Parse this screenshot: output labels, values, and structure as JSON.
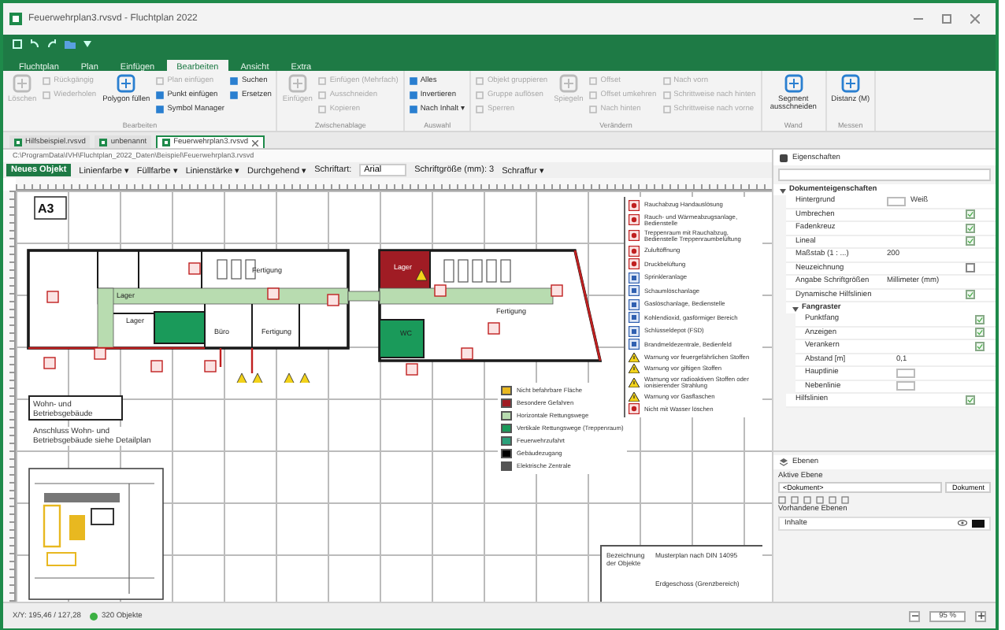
{
  "window": {
    "title": "Feuerwehrplan3.rvsvd - Fluchtplan 2022"
  },
  "ribbon_tabs": [
    {
      "label": "Fluchtplan",
      "selected": false
    },
    {
      "label": "Plan",
      "selected": false
    },
    {
      "label": "Einfügen",
      "selected": false
    },
    {
      "label": "Bearbeiten",
      "selected": true
    },
    {
      "label": "Ansicht",
      "selected": false
    },
    {
      "label": "Extra",
      "selected": false
    }
  ],
  "ribbon_groups": [
    {
      "label": "Bearbeiten",
      "items": [
        {
          "kind": "large",
          "label": "Löschen",
          "disabled": true
        },
        {
          "kind": "small",
          "label": "Rückgängig",
          "disabled": true
        },
        {
          "kind": "small",
          "label": "Wiederholen",
          "disabled": true
        },
        {
          "kind": "large",
          "label": "Polygon füllen",
          "disabled": false
        },
        {
          "kind": "small",
          "label": "Plan einfügen",
          "disabled": true
        },
        {
          "kind": "small",
          "label": "Punkt einfügen",
          "disabled": false
        },
        {
          "kind": "small",
          "label": "Symbol Manager",
          "disabled": false
        },
        {
          "kind": "small",
          "label": "Suchen",
          "disabled": false
        },
        {
          "kind": "small",
          "label": "Ersetzen",
          "disabled": false
        }
      ]
    },
    {
      "label": "Zwischenablage",
      "items": [
        {
          "kind": "large",
          "label": "Einfügen",
          "disabled": true
        },
        {
          "kind": "small",
          "label": "Einfügen (Mehrfach)",
          "disabled": true
        },
        {
          "kind": "small",
          "label": "Ausschneiden",
          "disabled": true
        },
        {
          "kind": "small",
          "label": "Kopieren",
          "disabled": true
        }
      ]
    },
    {
      "label": "Auswahl",
      "items": [
        {
          "kind": "small",
          "label": "Alles",
          "disabled": false
        },
        {
          "kind": "small",
          "label": "Invertieren",
          "disabled": false
        },
        {
          "kind": "small",
          "label": "Nach Inhalt ▾",
          "disabled": false
        }
      ]
    },
    {
      "label": "Verändern",
      "items": [
        {
          "kind": "small",
          "label": "Objekt gruppieren",
          "disabled": true
        },
        {
          "kind": "small",
          "label": "Gruppe auflösen",
          "disabled": true
        },
        {
          "kind": "small",
          "label": "Sperren",
          "disabled": true
        },
        {
          "kind": "large",
          "label": "Spiegeln",
          "disabled": true
        },
        {
          "kind": "small",
          "label": "Offset",
          "disabled": true
        },
        {
          "kind": "small",
          "label": "Offset umkehren",
          "disabled": true
        },
        {
          "kind": "small",
          "label": "Nach hinten",
          "disabled": true
        },
        {
          "kind": "small",
          "label": "Nach vorn",
          "disabled": true
        },
        {
          "kind": "small",
          "label": "Schrittweise nach hinten",
          "disabled": true
        },
        {
          "kind": "small",
          "label": "Schrittweise nach vorne",
          "disabled": true
        }
      ]
    },
    {
      "label": "Wand",
      "items": [
        {
          "kind": "large",
          "label": "Segment ausschneiden",
          "disabled": false
        }
      ]
    },
    {
      "label": "Messen",
      "items": [
        {
          "kind": "large",
          "label": "Distanz (M)",
          "disabled": false
        }
      ]
    }
  ],
  "document_tabs": [
    {
      "label": "Hilfsbeispiel.rvsvd",
      "selected": false
    },
    {
      "label": "unbenannt",
      "selected": false
    },
    {
      "label": "Feuerwehrplan3.rvsvd",
      "selected": true
    }
  ],
  "path": "C:\\ProgramData\\IVH\\Fluchtplan_2022_Daten\\Beispiel\\Feuerwehrplan3.rvsvd",
  "toolbar": {
    "new_object": "Neues Objekt",
    "line_color": "Linienfarbe ▾",
    "fill_color": "Füllfarbe ▾",
    "line_width": "Linienstärke ▾",
    "line_style": "Durchgehend ▾",
    "font_label": "Schriftart:",
    "font": "Arial",
    "font_size": "Schriftgröße (mm): 3",
    "hatch": "Schraffur ▾"
  },
  "plan": {
    "sheet_size": "A3",
    "rooms": [
      "Fertigung",
      "Büro",
      "Lager",
      "Fertigung",
      "Lager",
      "WC",
      "Fertigung",
      "Lager"
    ],
    "building_note": "Wohn- und Betriebsgebäude",
    "detail_note": "Anschluss Wohn- und Betriebsgebäude siehe Detailplan"
  },
  "legend_areas": [
    {
      "label": "Nicht befahrbare Fläche",
      "color": "#e8b820"
    },
    {
      "label": "Besondere Gefahren",
      "color": "#a01c24"
    },
    {
      "label": "Horizontale Rettungswege",
      "color": "#b8dcb0"
    },
    {
      "label": "Vertikale Rettungswege (Treppenraum)",
      "color": "#1a9a5a"
    },
    {
      "label": "Feuerwehrzufahrt",
      "color": "#2aa07a"
    },
    {
      "label": "Gebäudezugang",
      "color": "#000000"
    },
    {
      "label": "Elektrische Zentrale",
      "color": "#555555"
    }
  ],
  "legend_symbols": [
    {
      "label": "Rauchabzug Handauslösung",
      "kind": "red"
    },
    {
      "label": "Rauch- und Wärmeabzugsanlage, Bedienstelle",
      "kind": "red"
    },
    {
      "label": "Treppenraum mit Rauchabzug, Bedienstelle Treppenraumbelüftung",
      "kind": "red"
    },
    {
      "label": "Zuluftöffnung",
      "kind": "red"
    },
    {
      "label": "Druckbelüftung",
      "kind": "red"
    },
    {
      "label": "Sprinkleranlage",
      "kind": "blue"
    },
    {
      "label": "Schaumlöschanlage",
      "kind": "blue"
    },
    {
      "label": "Gaslöschanlage, Bedienstelle",
      "kind": "blue"
    },
    {
      "label": "Kohlendioxid, gasförmiger Bereich",
      "kind": "blue"
    },
    {
      "label": "Schlüsseldepot (FSD)",
      "kind": "blue"
    },
    {
      "label": "Brandmeldezentrale, Bedienfeld",
      "kind": "blue"
    },
    {
      "label": "Warnung vor feuergefährlichen Stoffen",
      "kind": "warning"
    },
    {
      "label": "Warnung vor giftigen Stoffen",
      "kind": "warning"
    },
    {
      "label": "Warnung vor radioaktiven Stoffen oder ionisierender Strahlung",
      "kind": "warning"
    },
    {
      "label": "Warnung vor Gasflaschen",
      "kind": "warning"
    },
    {
      "label": "Nicht mit Wasser löschen",
      "kind": "red"
    }
  ],
  "title_block": {
    "label": "Bezeichnung der Objekte",
    "title": "Musterplan nach DIN 14095",
    "subtitle": "Erdgeschoss (Grenzbereich)"
  },
  "properties": {
    "title": "Eigenschaften",
    "section": "Dokumenteigenschaften",
    "rows": [
      {
        "kind": "color",
        "label": "Hintergrund",
        "value": "Weiß"
      },
      {
        "kind": "check",
        "label": "Umbrechen",
        "checked": true
      },
      {
        "kind": "check",
        "label": "Fadenkreuz",
        "checked": true
      },
      {
        "kind": "check",
        "label": "Lineal",
        "checked": true
      },
      {
        "kind": "text",
        "label": "Maßstab (1 : ...)",
        "value": "200"
      },
      {
        "kind": "check",
        "label": "Neuzeichnung",
        "checked": false
      },
      {
        "kind": "text",
        "label": "Angabe Schriftgrößen",
        "value": "Millimeter (mm)"
      },
      {
        "kind": "check",
        "label": "Dynamische Hilfslinien",
        "checked": true
      }
    ],
    "subsection": "Fangraster",
    "sub_rows": [
      {
        "kind": "check",
        "label": "Punktfang",
        "checked": true
      },
      {
        "kind": "check",
        "label": "Anzeigen",
        "checked": true
      },
      {
        "kind": "check",
        "label": "Verankern",
        "checked": true
      },
      {
        "kind": "text",
        "label": "Abstand [m]",
        "value": "0,1"
      },
      {
        "kind": "color",
        "label": "Hauptlinie",
        "value": ""
      },
      {
        "kind": "color",
        "label": "Nebenlinie",
        "value": ""
      }
    ],
    "tail_rows": [
      {
        "kind": "check",
        "label": "Hilfslinien",
        "checked": true
      }
    ]
  },
  "layers": {
    "title": "Ebenen",
    "active_label": "Aktive Ebene",
    "active_value": "<Dokument>",
    "active_button": "Dokument",
    "list_label": "Vorhandene Ebenen",
    "items": [
      {
        "name": "Inhalte",
        "visible": true
      }
    ]
  },
  "status_bar": {
    "coords": "X/Y: 195,46 / 127,28",
    "objects": "320 Objekte",
    "zoom": "95 %"
  }
}
